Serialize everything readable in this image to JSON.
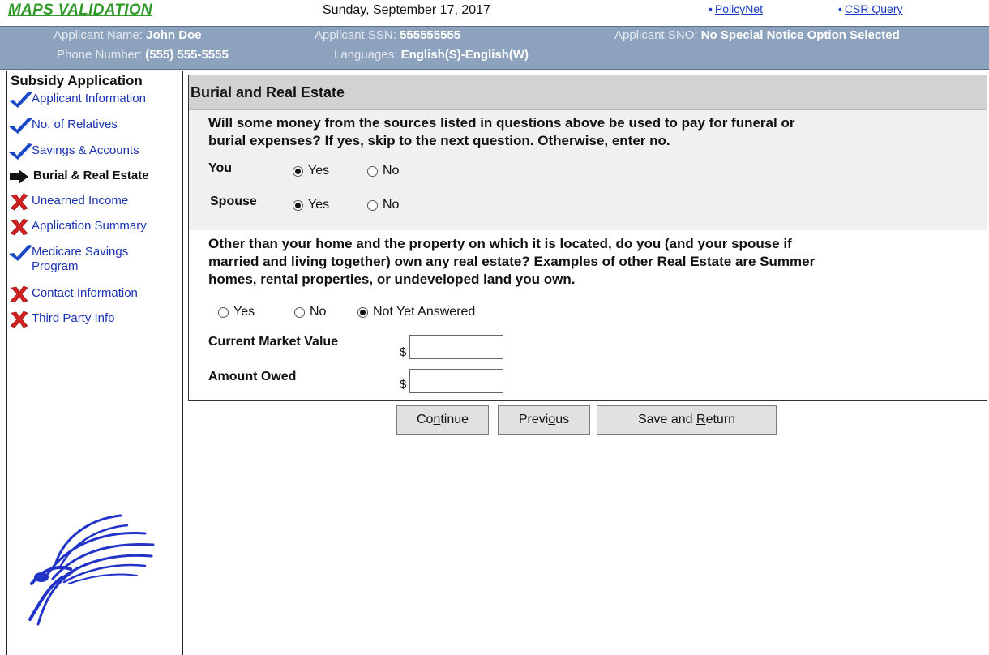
{
  "app": {
    "title": "MAPS VALIDATION",
    "date": "Sunday, September 17, 2017",
    "links": [
      "PolicyNet",
      "CSR Query"
    ]
  },
  "applicant": {
    "name_label": "Applicant Name:",
    "name": "John Doe",
    "ssn_label": "Applicant SSN:",
    "ssn": "555555555",
    "sno_label": "Applicant SNO:",
    "sno": "No Special Notice Option Selected",
    "phone_label": "Phone Number:",
    "phone": "(555) 555-5555",
    "languages_label": "Languages:",
    "languages": "English(S)-English(W)"
  },
  "sidebar": {
    "title": "Subsidy Application",
    "items": [
      {
        "label": "Applicant Information",
        "status": "complete",
        "icon": "check-icon"
      },
      {
        "label": "No. of Relatives",
        "status": "complete",
        "icon": "check-icon"
      },
      {
        "label": "Savings & Accounts",
        "status": "complete",
        "icon": "check-icon"
      },
      {
        "label": "Burial & Real Estate",
        "status": "current",
        "icon": "arrow-right-icon"
      },
      {
        "label": "Unearned Income",
        "status": "incomplete",
        "icon": "x-icon"
      },
      {
        "label": "Application Summary",
        "status": "incomplete",
        "icon": "x-icon"
      },
      {
        "label": "Medicare Savings",
        "label2": "Program",
        "status": "complete",
        "icon": "check-icon"
      },
      {
        "label": "Contact Information",
        "status": "incomplete",
        "icon": "x-icon"
      },
      {
        "label": "Third Party Info",
        "status": "incomplete",
        "icon": "x-icon"
      }
    ]
  },
  "main": {
    "title": "Burial and Real Estate",
    "q1": {
      "line1": "Will some money from the sources listed in questions above be used to pay for funeral or",
      "line2": "burial expenses? If yes, skip to the next question. Otherwise, enter no.",
      "you_label": "You",
      "spouse_label": "Spouse",
      "options": [
        "Yes",
        "No"
      ],
      "you_selected": "Yes",
      "spouse_selected": "Yes"
    },
    "q2": {
      "line1": "Other than your home and the property on which it is located, do you (and your spouse if",
      "line2": "married and living together) own any real estate? Examples of other Real Estate are Summer",
      "line3": "homes, rental properties, or undeveloped land you own.",
      "options": [
        "Yes",
        "No",
        "Not Yet Answered"
      ],
      "selected": "Not Yet Answered"
    },
    "market_value_label": "Current Market Value",
    "market_value": "",
    "amount_owed_label": "Amount Owed",
    "amount_owed": "",
    "currency_symbol": "$"
  },
  "buttons": {
    "continue": {
      "pre": "Co",
      "accel": "n",
      "post": "tinue"
    },
    "previous": {
      "pre": "Previ",
      "accel": "o",
      "post": "us"
    },
    "save_return": {
      "pre": "Save and ",
      "accel": "R",
      "post": "eturn"
    }
  },
  "colors": {
    "title_green": "#2f9a2a",
    "header_bg": "#8da2bd",
    "link_blue": "#1a3cc0",
    "check_blue": "#1a47c8",
    "x_red": "#d22020"
  }
}
